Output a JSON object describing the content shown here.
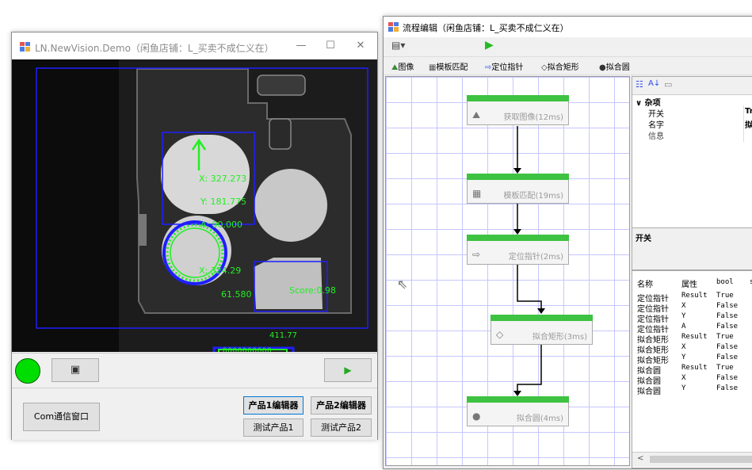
{
  "window1": {
    "title": "LN.NewVision.Demo（闲鱼店铺：L_买卖不成仁义在）",
    "controls": [
      "—",
      "☐",
      "✕"
    ],
    "overlay": {
      "x_label": "X: 327.273",
      "y_label": "Y: 181.775",
      "a_label": "A: 90.000",
      "circle_x_label": "X: 324.29",
      "circle_y_label": "61.580",
      "score_label": "Score:0.98",
      "rect_label": "0000000000",
      "rect_value": "411.77"
    },
    "buttons": {
      "com_window": "Com通信窗口",
      "product1_editor": "产品1编辑器",
      "product2_editor": "产品2编辑器",
      "test_product1": "测试产品1",
      "test_product2": "测试产品2"
    },
    "status_color": "#00dd00"
  },
  "window2": {
    "title": "流程编辑（闲鱼店铺：L_买卖不成仁义在）",
    "toolbar_items": [
      "图像",
      "模板匹配",
      "定位指针",
      "拟合矩形",
      "拟合圆"
    ],
    "nodes": [
      {
        "label": "获取图像(12ms)"
      },
      {
        "label": "模板匹配(19ms)"
      },
      {
        "label": "定位指针(2ms)"
      },
      {
        "label": "拟合矩形(3ms)"
      },
      {
        "label": "拟合圆(4ms)"
      }
    ],
    "properties": {
      "category": "杂项",
      "rows": [
        {
          "name": "开关",
          "value": "Tr"
        },
        {
          "name": "名字",
          "value": "拟"
        },
        {
          "name": "信息",
          "value": ""
        }
      ],
      "description_title": "开关"
    },
    "table": {
      "headers": [
        "名称",
        "属性",
        "bool",
        "s"
      ],
      "rows": [
        [
          "定位指针",
          "Result",
          "True"
        ],
        [
          "定位指针",
          "X",
          "False"
        ],
        [
          "定位指针",
          "Y",
          "False"
        ],
        [
          "定位指针",
          "A",
          "False"
        ],
        [
          "拟合矩形",
          "Result",
          "True"
        ],
        [
          "拟合矩形",
          "X",
          "False"
        ],
        [
          "拟合矩形",
          "Y",
          "False"
        ],
        [
          "拟合圆",
          "Result",
          "True"
        ],
        [
          "拟合圆",
          "X",
          "False"
        ],
        [
          "拟合圆",
          "Y",
          "False"
        ]
      ]
    },
    "scroll_left": "<"
  },
  "colors": {
    "accent_green": "#3dc241",
    "overlay_green": "#22ee22",
    "roi_blue": "#1e1eff"
  }
}
